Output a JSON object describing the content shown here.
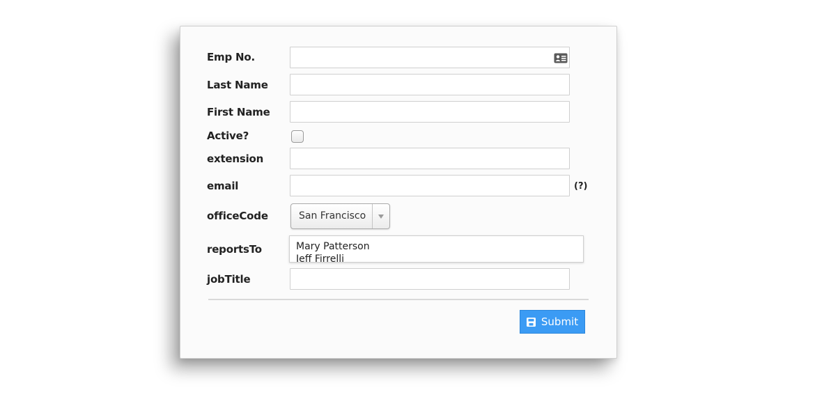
{
  "form": {
    "emp_no": {
      "label": "Emp No.",
      "value": ""
    },
    "last_name": {
      "label": "Last Name",
      "value": ""
    },
    "first_name": {
      "label": "First Name",
      "value": ""
    },
    "active": {
      "label": "Active?",
      "checked": false
    },
    "extension": {
      "label": "extension",
      "value": ""
    },
    "email": {
      "label": "email",
      "value": "",
      "help": "(?)"
    },
    "office_code": {
      "label": "officeCode",
      "selected": "San Francisco"
    },
    "reports_to": {
      "label": "reportsTo",
      "options": [
        "Mary Patterson",
        "Jeff Firrelli"
      ]
    },
    "job_title": {
      "label": "jobTitle",
      "value": ""
    }
  },
  "actions": {
    "submit_label": "Submit"
  },
  "icons": {
    "id_card": "id-card-icon",
    "save": "save-icon",
    "dropdown": "chevron-down-icon"
  },
  "colors": {
    "primary": "#3b9bf4",
    "border": "#cfcfcf"
  }
}
